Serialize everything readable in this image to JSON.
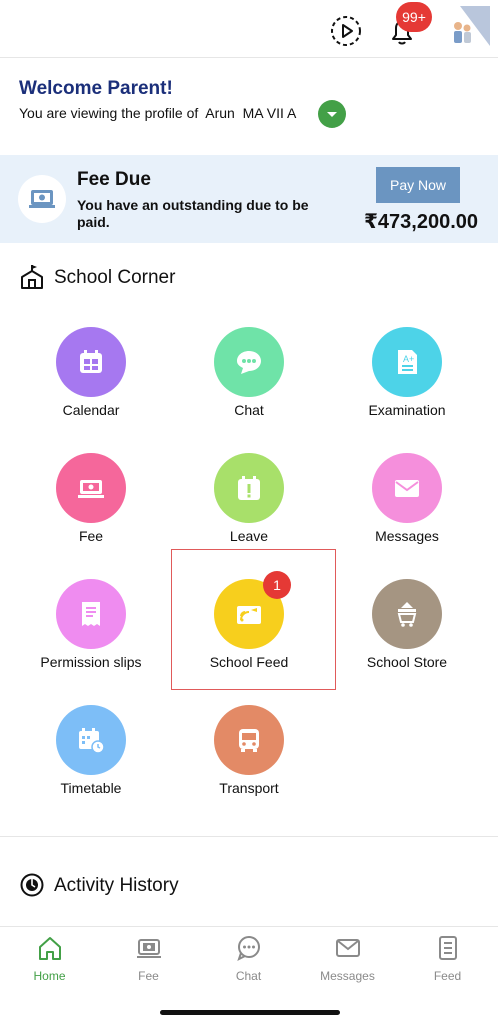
{
  "header": {
    "notification_count": "99+"
  },
  "welcome": {
    "title": "Welcome Parent!",
    "subtitle": "You are viewing the profile of  Arun  MA VII A"
  },
  "fee_due": {
    "title": "Fee Due",
    "text": "You have an outstanding due to be paid.",
    "button": "Pay Now",
    "amount": "₹473,200.00"
  },
  "school_corner": {
    "title": "School Corner",
    "items": [
      {
        "label": "Calendar",
        "color": "#a678f0",
        "icon": "calendar-icon"
      },
      {
        "label": "Chat",
        "color": "#6fe3a8",
        "icon": "chat-icon"
      },
      {
        "label": "Examination",
        "color": "#4dd3e8",
        "icon": "exam-icon"
      },
      {
        "label": "Fee",
        "color": "#f5679b",
        "icon": "fee-icon"
      },
      {
        "label": "Leave",
        "color": "#a8e06a",
        "icon": "leave-icon"
      },
      {
        "label": "Messages",
        "color": "#f58fdc",
        "icon": "mail-icon"
      },
      {
        "label": "Permission slips",
        "color": "#ef8cf0",
        "icon": "slip-icon"
      },
      {
        "label": "School Feed",
        "color": "#f7cf1d",
        "icon": "feed-icon",
        "badge": "1"
      },
      {
        "label": "School Store",
        "color": "#a59582",
        "icon": "store-icon"
      },
      {
        "label": "Timetable",
        "color": "#7dbef7",
        "icon": "timetable-icon"
      },
      {
        "label": "Transport",
        "color": "#e38a66",
        "icon": "bus-icon"
      }
    ]
  },
  "activity": {
    "title": "Activity History"
  },
  "bottom_nav": {
    "items": [
      {
        "label": "Home",
        "icon": "home-icon",
        "active": true
      },
      {
        "label": "Fee",
        "icon": "fee-icon"
      },
      {
        "label": "Chat",
        "icon": "chat-icon"
      },
      {
        "label": "Messages",
        "icon": "mail-icon"
      },
      {
        "label": "Feed",
        "icon": "feed-icon"
      }
    ]
  },
  "colors": {
    "accent_green": "#43a047",
    "title_blue": "#1b2f7a",
    "badge_red": "#e53935",
    "pay_button": "#6b95c1",
    "fee_banner": "#e8f1fa"
  }
}
